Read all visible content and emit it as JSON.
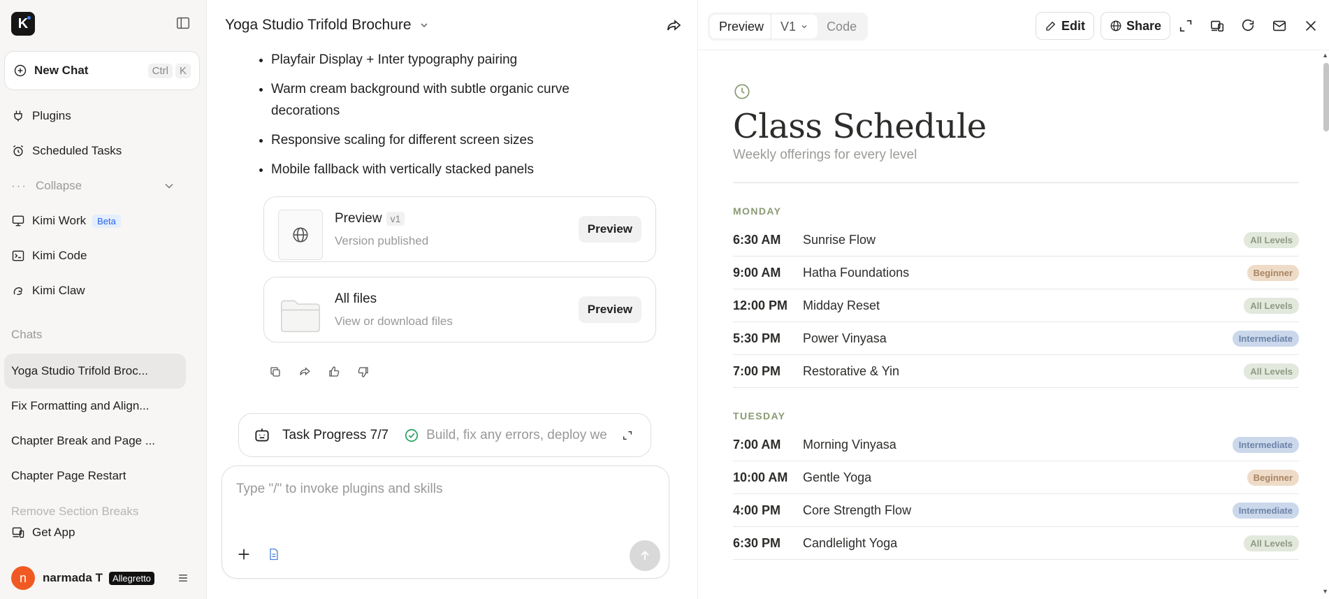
{
  "sidebar": {
    "logo": "K",
    "new_chat": {
      "label": "New Chat",
      "kbd1": "Ctrl",
      "kbd2": "K"
    },
    "nav": {
      "plugins": "Plugins",
      "scheduled": "Scheduled Tasks",
      "collapse": "Collapse",
      "kimi_work": "Kimi Work",
      "beta": "Beta",
      "kimi_code": "Kimi Code",
      "kimi_claw": "Kimi Claw"
    },
    "chats_label": "Chats",
    "chats": [
      "Yoga Studio Trifold Broc...",
      "Fix Formatting and Align...",
      "Chapter Break and Page ...",
      "Chapter Page Restart",
      "Remove Section Breaks"
    ],
    "get_app": "Get App",
    "user": {
      "initial": "n",
      "name": "narmada T",
      "plan": "Allegretto"
    }
  },
  "chat": {
    "title": "Yoga Studio Trifold Brochure",
    "bullets": [
      "Playfair Display + Inter typography pairing",
      "Warm cream background with subtle organic curve decorations",
      "Responsive scaling for different screen sizes",
      "Mobile fallback with vertically stacked panels"
    ],
    "cards": {
      "preview": {
        "title": "Preview",
        "tag": "v1",
        "sub": "Version published",
        "button": "Preview"
      },
      "files": {
        "title": "All files",
        "sub": "View or download files",
        "button": "Preview"
      }
    },
    "task": {
      "label": "Task Progress 7/7",
      "desc": "Build, fix any errors, deploy we"
    },
    "composer": {
      "placeholder": "Type \"/\" to invoke plugins and skills"
    }
  },
  "preview": {
    "tabs": {
      "preview": "Preview",
      "version": "V1",
      "code": "Code"
    },
    "buttons": {
      "edit": "Edit",
      "share": "Share"
    },
    "doc": {
      "title": "Class Schedule",
      "subtitle": "Weekly offerings for every level",
      "days": [
        {
          "name": "MONDAY",
          "classes": [
            {
              "time": "6:30 AM",
              "name": "Sunrise Flow",
              "level": "All Levels",
              "kind": "all"
            },
            {
              "time": "9:00 AM",
              "name": "Hatha Foundations",
              "level": "Beginner",
              "kind": "beg"
            },
            {
              "time": "12:00 PM",
              "name": "Midday Reset",
              "level": "All Levels",
              "kind": "all"
            },
            {
              "time": "5:30 PM",
              "name": "Power Vinyasa",
              "level": "Intermediate",
              "kind": "int"
            },
            {
              "time": "7:00 PM",
              "name": "Restorative & Yin",
              "level": "All Levels",
              "kind": "all"
            }
          ]
        },
        {
          "name": "TUESDAY",
          "classes": [
            {
              "time": "7:00 AM",
              "name": "Morning Vinyasa",
              "level": "Intermediate",
              "kind": "int"
            },
            {
              "time": "10:00 AM",
              "name": "Gentle Yoga",
              "level": "Beginner",
              "kind": "beg"
            },
            {
              "time": "4:00 PM",
              "name": "Core Strength Flow",
              "level": "Intermediate",
              "kind": "int"
            },
            {
              "time": "6:30 PM",
              "name": "Candlelight Yoga",
              "level": "All Levels",
              "kind": "all"
            }
          ]
        }
      ]
    }
  },
  "colors": {
    "accent_green": "#8a9a74",
    "avatar": "#f05a22",
    "level_all": "#e2e8dc",
    "level_beginner": "#eedcc9",
    "level_intermediate": "#cbd8eb",
    "beta": "#2563eb"
  }
}
